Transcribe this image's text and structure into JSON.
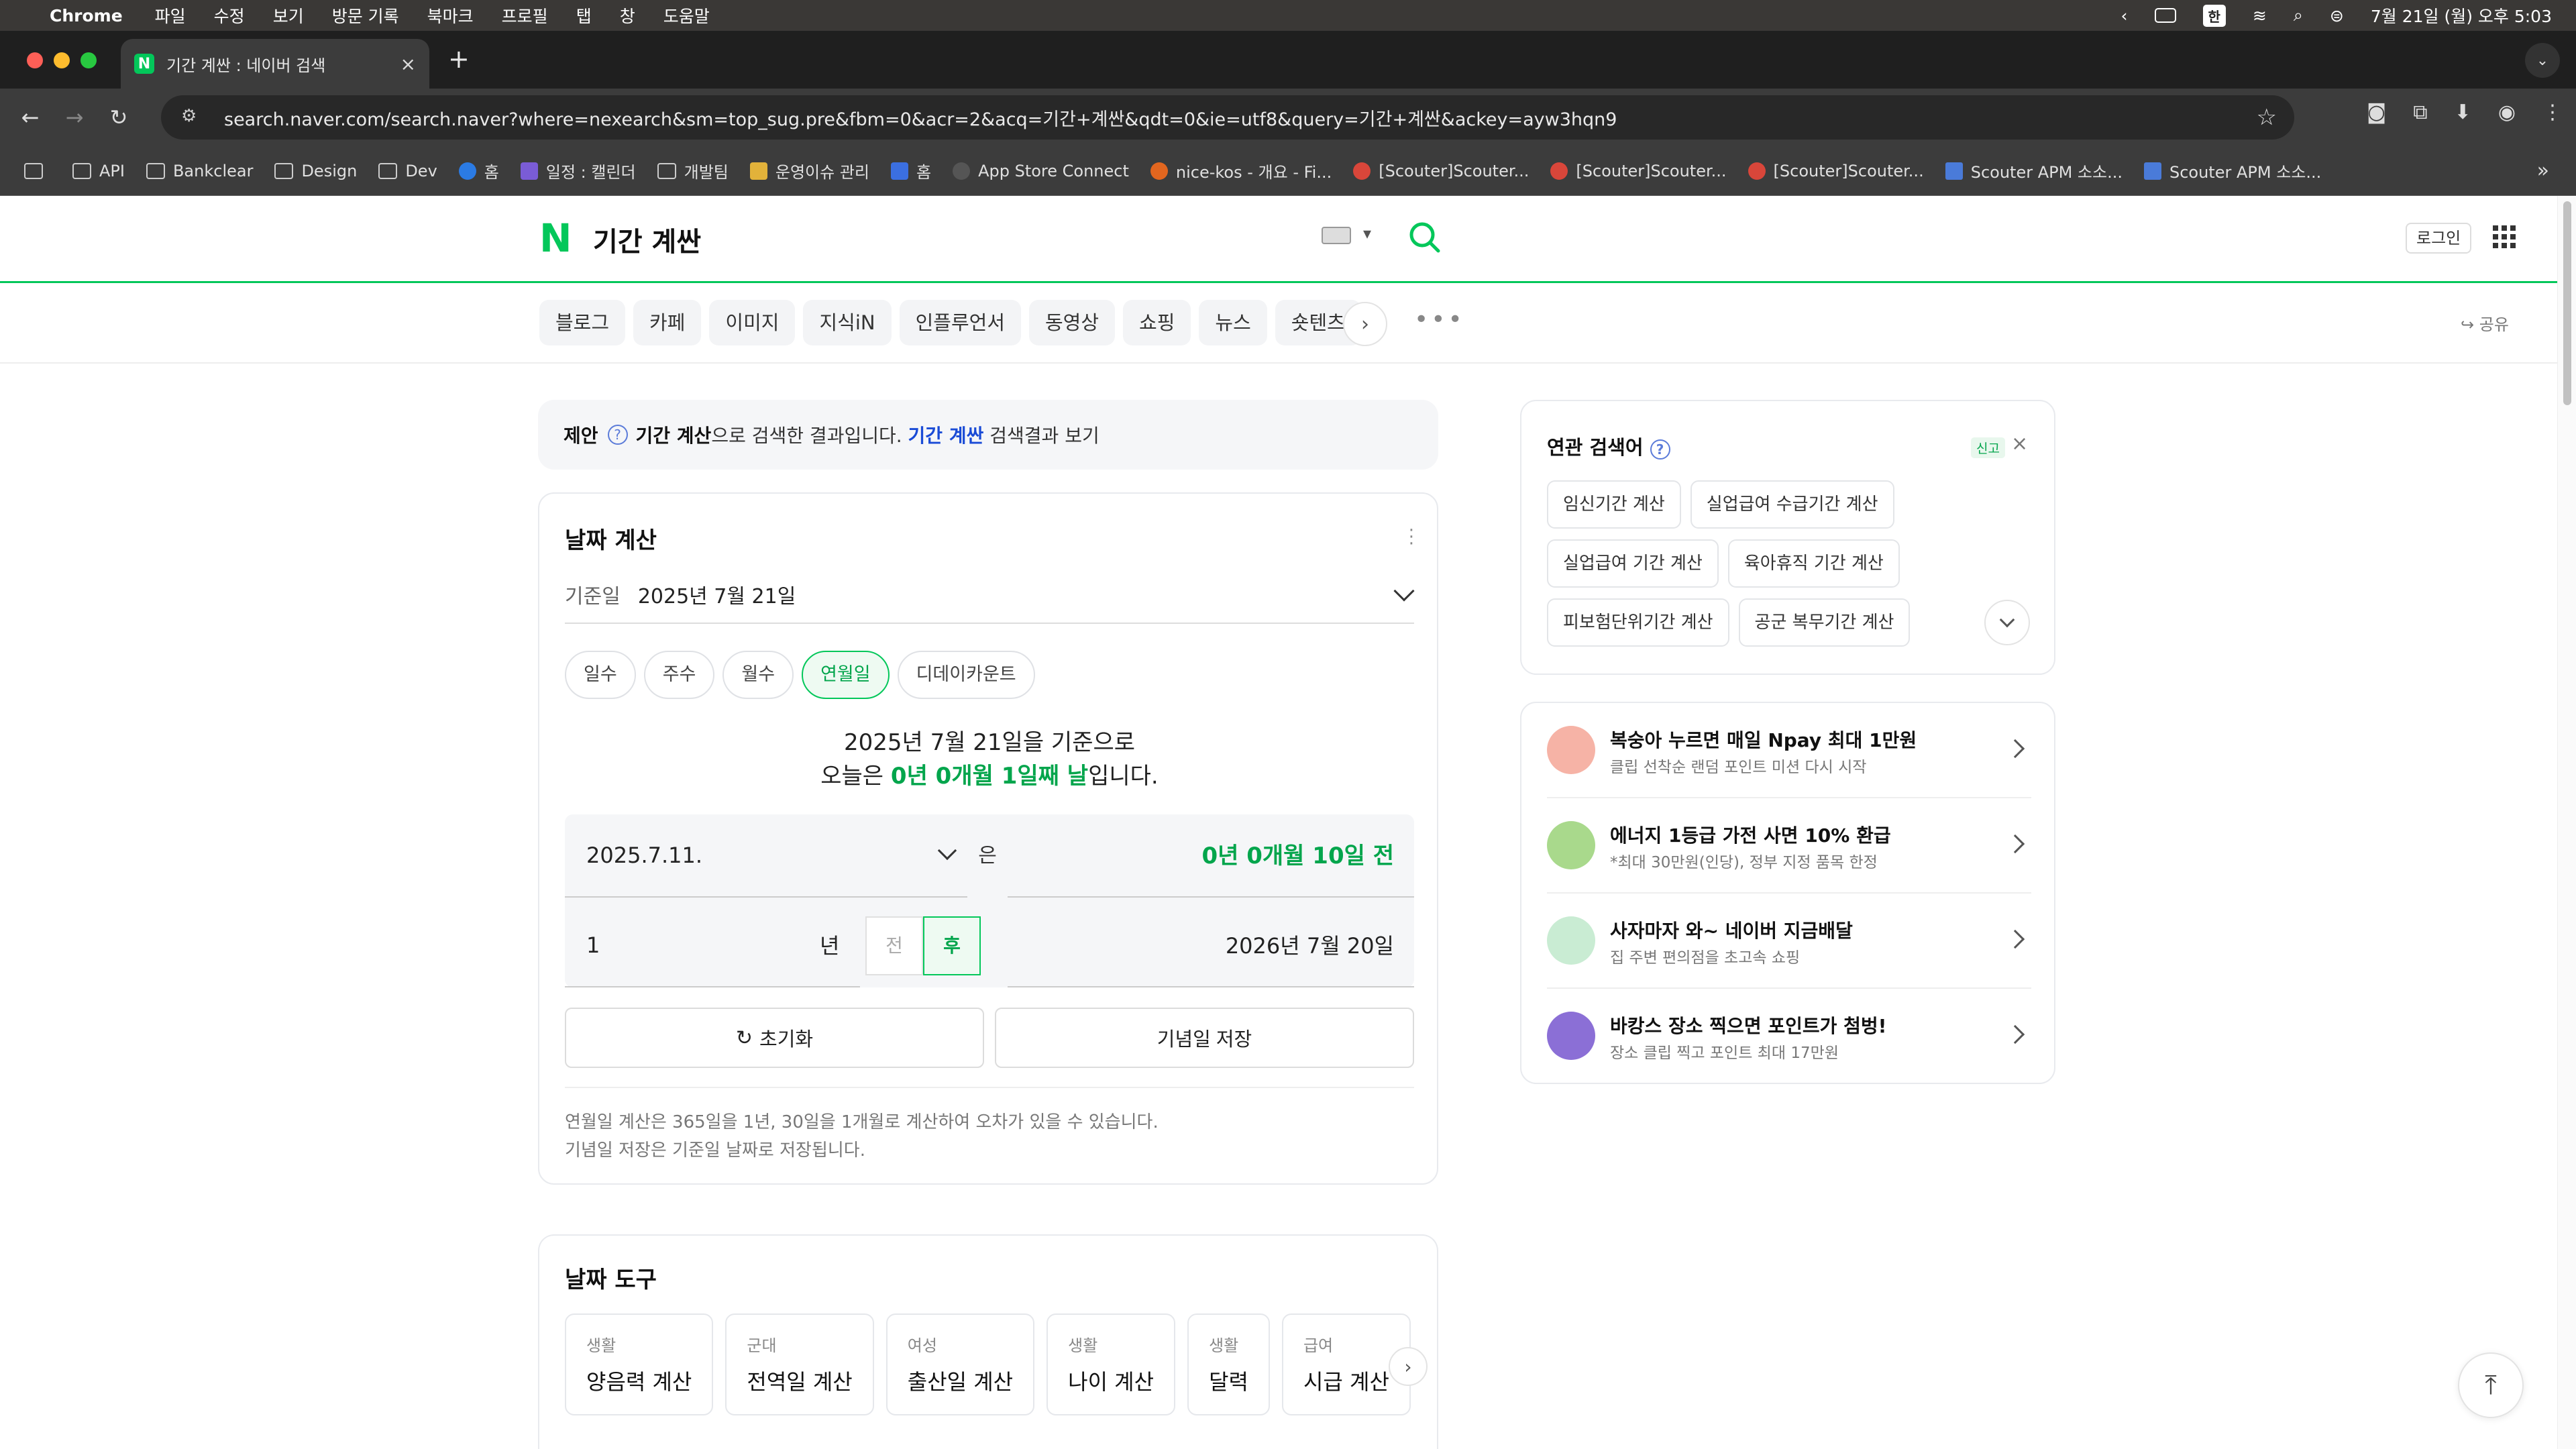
{
  "macos_menubar": {
    "app_name": "Chrome",
    "menu_items": [
      "파일",
      "수정",
      "보기",
      "방문 기록",
      "북마크",
      "프로필",
      "탭",
      "창",
      "도움말"
    ],
    "input_method": "한",
    "datetime": "7월 21일 (월) 오후 5:03"
  },
  "browser": {
    "tab_title": "기간 계싼 : 네이버 검색",
    "favicon_letter": "N",
    "url": "search.naver.com/search.naver?where=nexearch&sm=top_sug.pre&fbm=0&acr=2&acq=기간+계싼&qdt=0&ie=utf8&query=기간+계싼&ackey=ayw3hqn9",
    "bookmarks": [
      "API",
      "Bankclear",
      "Design",
      "Dev",
      "홈",
      "일정 : 캘린더",
      "개발팀",
      "운영이슈 관리",
      "홈",
      "App Store Connect",
      "nice-kos - 개요 - Fi...",
      "[Scouter]Scouter...",
      "[Scouter]Scouter...",
      "[Scouter]Scouter...",
      "Scouter APM 소소...",
      "Scouter APM 소소..."
    ],
    "bookmark_overflow": "»"
  },
  "naver": {
    "logo": "N",
    "query": "기간 계싼",
    "login_label": "로그인",
    "categories": [
      "블로그",
      "카페",
      "이미지",
      "지식iN",
      "인플루언서",
      "동영상",
      "쇼핑",
      "뉴스",
      "숏텐츠"
    ],
    "more_label": "•••",
    "share_label": "공유"
  },
  "suggestion": {
    "prefix": "제안",
    "corrected": "기간 계산",
    "middle": "으로 검색한 결과입니다.",
    "original_link": "기간 계싼",
    "suffix": "검색결과 보기"
  },
  "date_calc": {
    "title": "날짜 계산",
    "base_label": "기준일",
    "base_value": "2025년 7월 21일",
    "modes": [
      "일수",
      "주수",
      "월수",
      "연월일",
      "디데이카운트"
    ],
    "active_mode": "연월일",
    "result_line1": "2025년 7월 21일을 기준으로",
    "result_prefix": "오늘은",
    "result_highlight": "0년 0개월 1일째 날",
    "result_suffix": "입니다.",
    "compare_date": "2025.7.11.",
    "compare_particle": "은",
    "compare_result": "0년 0개월 10일 전",
    "offset_value": "1",
    "offset_unit": "년",
    "dir_before": "전",
    "dir_after": "후",
    "target_date": "2026년 7월 20일",
    "reset_label": "초기화",
    "save_label": "기념일 저장",
    "note1": "연월일 계산은 365일을 1년, 30일을 1개월로 계산하여 오차가 있을 수 있습니다.",
    "note2": "기념일 저장은 기준일 날짜로 저장됩니다."
  },
  "date_tools": {
    "title": "날짜 도구",
    "items": [
      {
        "category": "생활",
        "name": "양음력 계산"
      },
      {
        "category": "군대",
        "name": "전역일 계산"
      },
      {
        "category": "여성",
        "name": "출산일 계산"
      },
      {
        "category": "생활",
        "name": "나이 계산"
      },
      {
        "category": "생활",
        "name": "달력"
      },
      {
        "category": "급여",
        "name": "시급 계산"
      }
    ]
  },
  "related": {
    "title": "연관 검색어",
    "report_label": "신고",
    "chips": [
      "임신기간 계산",
      "실업급여 수급기간 계산",
      "실업급여 기간 계산",
      "육아휴직 기간 계산",
      "피보험단위기간 계산",
      "공군 복무기간 계산"
    ]
  },
  "promos": [
    {
      "title": "복숭아 누르면 매일 Npay 최대 1만원",
      "subtitle": "클립 선착순 랜덤 포인트 미션 다시 시작",
      "color": "#f6b3a6"
    },
    {
      "title": "에너지 1등급 가전 사면 10% 환급",
      "subtitle": "*최대 30만원(인당), 정부 지정 품목 한정",
      "color": "#a9d98c"
    },
    {
      "title": "사자마자 와~ 네이버 지금배달",
      "subtitle": "집 주변 편의점을 초고속 쇼핑",
      "color": "#c9ecd3"
    },
    {
      "title": "바캉스 장소 찍으면 포인트가 첨벙!",
      "subtitle": "장소 클립 찍고 포인트 최대 17만원",
      "color": "#8b6fd6"
    }
  ],
  "colors": {
    "naver_green": "#03c75a",
    "result_green": "#03a54c",
    "link_blue": "#1a4bd6"
  }
}
